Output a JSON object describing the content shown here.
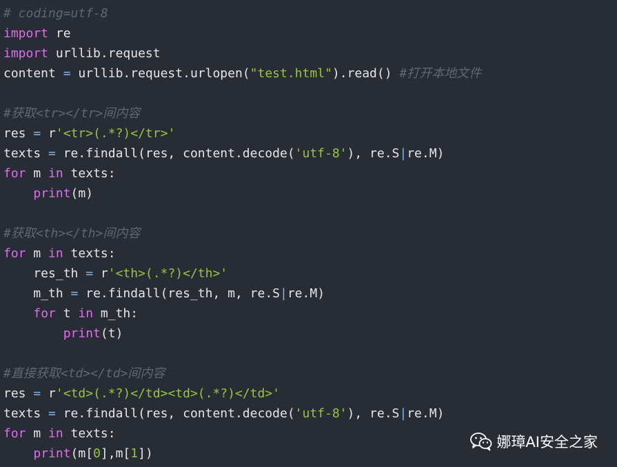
{
  "lines": [
    [
      {
        "t": "# coding=utf-8",
        "c": "cm"
      }
    ],
    [
      {
        "t": "import",
        "c": "kw"
      },
      {
        "t": " re",
        "c": "pl"
      }
    ],
    [
      {
        "t": "import",
        "c": "kw"
      },
      {
        "t": " urllib.request",
        "c": "pl"
      }
    ],
    [
      {
        "t": "content ",
        "c": "pl"
      },
      {
        "t": "=",
        "c": "op"
      },
      {
        "t": " urllib.request.urlopen(",
        "c": "pl"
      },
      {
        "t": "\"test.html\"",
        "c": "str"
      },
      {
        "t": ").read() ",
        "c": "pl"
      },
      {
        "t": "#打开本地文件",
        "c": "cm"
      }
    ],
    [],
    [
      {
        "t": "#获取<tr></tr>间内容",
        "c": "cm"
      }
    ],
    [
      {
        "t": "res ",
        "c": "pl"
      },
      {
        "t": "=",
        "c": "op"
      },
      {
        "t": " r",
        "c": "pl"
      },
      {
        "t": "'<tr>(.*?)</tr>'",
        "c": "str"
      }
    ],
    [
      {
        "t": "texts ",
        "c": "pl"
      },
      {
        "t": "=",
        "c": "op"
      },
      {
        "t": " re.findall(res, content.decode(",
        "c": "pl"
      },
      {
        "t": "'utf-8'",
        "c": "str"
      },
      {
        "t": "), re.S",
        "c": "pl"
      },
      {
        "t": "|",
        "c": "op"
      },
      {
        "t": "re.M)",
        "c": "pl"
      }
    ],
    [
      {
        "t": "for",
        "c": "kw"
      },
      {
        "t": " m ",
        "c": "pl"
      },
      {
        "t": "in",
        "c": "kw"
      },
      {
        "t": " texts:",
        "c": "pl"
      }
    ],
    [
      {
        "t": "    ",
        "c": "pl"
      },
      {
        "t": "print",
        "c": "bi"
      },
      {
        "t": "(m)",
        "c": "pl"
      }
    ],
    [],
    [
      {
        "t": "#获取<th></th>间内容",
        "c": "cm"
      }
    ],
    [
      {
        "t": "for",
        "c": "kw"
      },
      {
        "t": " m ",
        "c": "pl"
      },
      {
        "t": "in",
        "c": "kw"
      },
      {
        "t": " texts:",
        "c": "pl"
      }
    ],
    [
      {
        "t": "    res_th ",
        "c": "pl"
      },
      {
        "t": "=",
        "c": "op"
      },
      {
        "t": " r",
        "c": "pl"
      },
      {
        "t": "'<th>(.*?)</th>'",
        "c": "str"
      }
    ],
    [
      {
        "t": "    m_th ",
        "c": "pl"
      },
      {
        "t": "=",
        "c": "op"
      },
      {
        "t": " re.findall(res_th, m, re.S",
        "c": "pl"
      },
      {
        "t": "|",
        "c": "op"
      },
      {
        "t": "re.M)",
        "c": "pl"
      }
    ],
    [
      {
        "t": "    ",
        "c": "pl"
      },
      {
        "t": "for",
        "c": "kw"
      },
      {
        "t": " t ",
        "c": "pl"
      },
      {
        "t": "in",
        "c": "kw"
      },
      {
        "t": " m_th:",
        "c": "pl"
      }
    ],
    [
      {
        "t": "        ",
        "c": "pl"
      },
      {
        "t": "print",
        "c": "bi"
      },
      {
        "t": "(t)",
        "c": "pl"
      }
    ],
    [],
    [
      {
        "t": "#直接获取<td></td>间内容",
        "c": "cm"
      }
    ],
    [
      {
        "t": "res ",
        "c": "pl"
      },
      {
        "t": "=",
        "c": "op"
      },
      {
        "t": " r",
        "c": "pl"
      },
      {
        "t": "'<td>(.*?)</td><td>(.*?)</td>'",
        "c": "str"
      }
    ],
    [
      {
        "t": "texts ",
        "c": "pl"
      },
      {
        "t": "=",
        "c": "op"
      },
      {
        "t": " re.findall(res, content.decode(",
        "c": "pl"
      },
      {
        "t": "'utf-8'",
        "c": "str"
      },
      {
        "t": "), re.S",
        "c": "pl"
      },
      {
        "t": "|",
        "c": "op"
      },
      {
        "t": "re.M)",
        "c": "pl"
      }
    ],
    [
      {
        "t": "for",
        "c": "kw"
      },
      {
        "t": " m ",
        "c": "pl"
      },
      {
        "t": "in",
        "c": "kw"
      },
      {
        "t": " texts:",
        "c": "pl"
      }
    ],
    [
      {
        "t": "    ",
        "c": "pl"
      },
      {
        "t": "print",
        "c": "bi"
      },
      {
        "t": "(m[",
        "c": "pl"
      },
      {
        "t": "0",
        "c": "num"
      },
      {
        "t": "],m[",
        "c": "pl"
      },
      {
        "t": "1",
        "c": "num"
      },
      {
        "t": "])",
        "c": "pl"
      }
    ]
  ],
  "watermark": {
    "icon": "wechat-icon",
    "text": "娜璋AI安全之家"
  }
}
